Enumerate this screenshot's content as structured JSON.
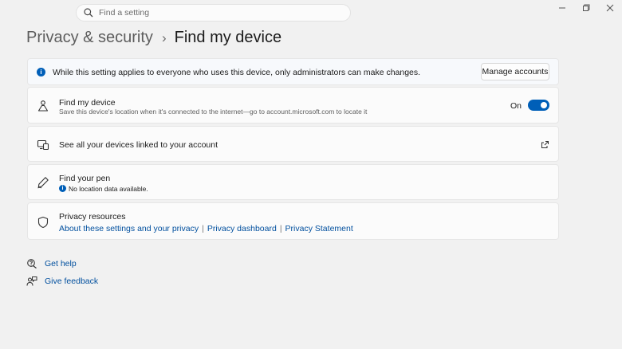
{
  "search": {
    "placeholder": "Find a setting",
    "icon": "search-icon"
  },
  "window": {
    "controls": [
      "minimize-icon",
      "restore-icon",
      "close-icon"
    ]
  },
  "breadcrumb": {
    "parent": "Privacy & security",
    "separator": "›",
    "current": "Find my device"
  },
  "banner": {
    "text": "While this setting applies to everyone who uses this device, only administrators can make changes.",
    "button": "Manage accounts",
    "icon": "info-icon"
  },
  "find_my_device": {
    "title": "Find my device",
    "description": "Save this device's location when it's connected to the internet—go to account.microsoft.com to locate it",
    "toggle_label": "On",
    "toggle_on": true,
    "icon": "location-person-icon"
  },
  "devices": {
    "title": "See all your devices linked to your account",
    "icon": "devices-icon",
    "action_icon": "open-external-icon"
  },
  "find_pen": {
    "title": "Find your pen",
    "status": "No location data available.",
    "icon": "pen-icon"
  },
  "privacy_resources": {
    "title": "Privacy resources",
    "links": [
      "About these settings and your privacy",
      "Privacy dashboard",
      "Privacy Statement"
    ],
    "icon": "shield-icon"
  },
  "help": [
    {
      "label": "Get help",
      "icon": "help-icon"
    },
    {
      "label": "Give feedback",
      "icon": "feedback-icon"
    }
  ],
  "colors": {
    "accent": "#005fb8",
    "link": "#004f9e",
    "background": "#f1f1f1",
    "card": "#fbfbfb"
  }
}
